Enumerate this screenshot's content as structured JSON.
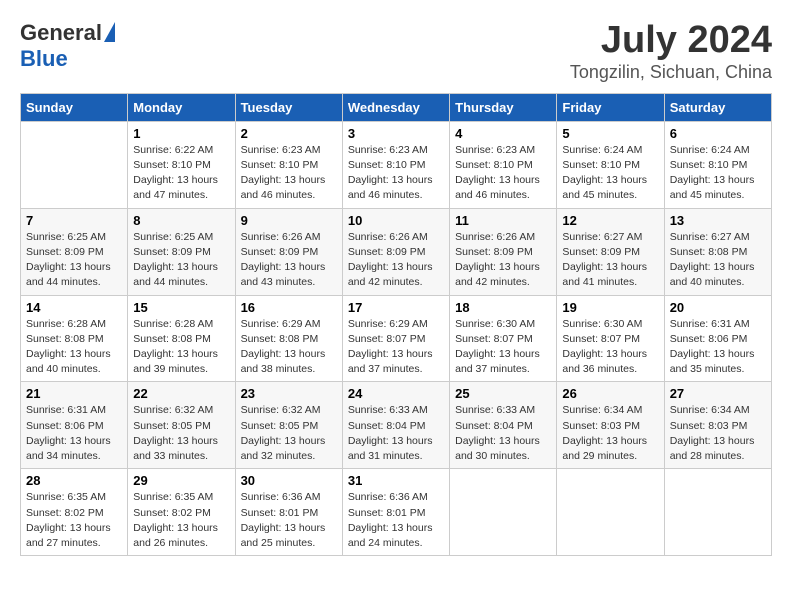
{
  "header": {
    "logo_general": "General",
    "logo_blue": "Blue",
    "month_year": "July 2024",
    "location": "Tongzilin, Sichuan, China"
  },
  "days_of_week": [
    "Sunday",
    "Monday",
    "Tuesday",
    "Wednesday",
    "Thursday",
    "Friday",
    "Saturday"
  ],
  "weeks": [
    [
      {
        "num": "",
        "detail": ""
      },
      {
        "num": "1",
        "detail": "Sunrise: 6:22 AM\nSunset: 8:10 PM\nDaylight: 13 hours\nand 47 minutes."
      },
      {
        "num": "2",
        "detail": "Sunrise: 6:23 AM\nSunset: 8:10 PM\nDaylight: 13 hours\nand 46 minutes."
      },
      {
        "num": "3",
        "detail": "Sunrise: 6:23 AM\nSunset: 8:10 PM\nDaylight: 13 hours\nand 46 minutes."
      },
      {
        "num": "4",
        "detail": "Sunrise: 6:23 AM\nSunset: 8:10 PM\nDaylight: 13 hours\nand 46 minutes."
      },
      {
        "num": "5",
        "detail": "Sunrise: 6:24 AM\nSunset: 8:10 PM\nDaylight: 13 hours\nand 45 minutes."
      },
      {
        "num": "6",
        "detail": "Sunrise: 6:24 AM\nSunset: 8:10 PM\nDaylight: 13 hours\nand 45 minutes."
      }
    ],
    [
      {
        "num": "7",
        "detail": "Sunrise: 6:25 AM\nSunset: 8:09 PM\nDaylight: 13 hours\nand 44 minutes."
      },
      {
        "num": "8",
        "detail": "Sunrise: 6:25 AM\nSunset: 8:09 PM\nDaylight: 13 hours\nand 44 minutes."
      },
      {
        "num": "9",
        "detail": "Sunrise: 6:26 AM\nSunset: 8:09 PM\nDaylight: 13 hours\nand 43 minutes."
      },
      {
        "num": "10",
        "detail": "Sunrise: 6:26 AM\nSunset: 8:09 PM\nDaylight: 13 hours\nand 42 minutes."
      },
      {
        "num": "11",
        "detail": "Sunrise: 6:26 AM\nSunset: 8:09 PM\nDaylight: 13 hours\nand 42 minutes."
      },
      {
        "num": "12",
        "detail": "Sunrise: 6:27 AM\nSunset: 8:09 PM\nDaylight: 13 hours\nand 41 minutes."
      },
      {
        "num": "13",
        "detail": "Sunrise: 6:27 AM\nSunset: 8:08 PM\nDaylight: 13 hours\nand 40 minutes."
      }
    ],
    [
      {
        "num": "14",
        "detail": "Sunrise: 6:28 AM\nSunset: 8:08 PM\nDaylight: 13 hours\nand 40 minutes."
      },
      {
        "num": "15",
        "detail": "Sunrise: 6:28 AM\nSunset: 8:08 PM\nDaylight: 13 hours\nand 39 minutes."
      },
      {
        "num": "16",
        "detail": "Sunrise: 6:29 AM\nSunset: 8:08 PM\nDaylight: 13 hours\nand 38 minutes."
      },
      {
        "num": "17",
        "detail": "Sunrise: 6:29 AM\nSunset: 8:07 PM\nDaylight: 13 hours\nand 37 minutes."
      },
      {
        "num": "18",
        "detail": "Sunrise: 6:30 AM\nSunset: 8:07 PM\nDaylight: 13 hours\nand 37 minutes."
      },
      {
        "num": "19",
        "detail": "Sunrise: 6:30 AM\nSunset: 8:07 PM\nDaylight: 13 hours\nand 36 minutes."
      },
      {
        "num": "20",
        "detail": "Sunrise: 6:31 AM\nSunset: 8:06 PM\nDaylight: 13 hours\nand 35 minutes."
      }
    ],
    [
      {
        "num": "21",
        "detail": "Sunrise: 6:31 AM\nSunset: 8:06 PM\nDaylight: 13 hours\nand 34 minutes."
      },
      {
        "num": "22",
        "detail": "Sunrise: 6:32 AM\nSunset: 8:05 PM\nDaylight: 13 hours\nand 33 minutes."
      },
      {
        "num": "23",
        "detail": "Sunrise: 6:32 AM\nSunset: 8:05 PM\nDaylight: 13 hours\nand 32 minutes."
      },
      {
        "num": "24",
        "detail": "Sunrise: 6:33 AM\nSunset: 8:04 PM\nDaylight: 13 hours\nand 31 minutes."
      },
      {
        "num": "25",
        "detail": "Sunrise: 6:33 AM\nSunset: 8:04 PM\nDaylight: 13 hours\nand 30 minutes."
      },
      {
        "num": "26",
        "detail": "Sunrise: 6:34 AM\nSunset: 8:03 PM\nDaylight: 13 hours\nand 29 minutes."
      },
      {
        "num": "27",
        "detail": "Sunrise: 6:34 AM\nSunset: 8:03 PM\nDaylight: 13 hours\nand 28 minutes."
      }
    ],
    [
      {
        "num": "28",
        "detail": "Sunrise: 6:35 AM\nSunset: 8:02 PM\nDaylight: 13 hours\nand 27 minutes."
      },
      {
        "num": "29",
        "detail": "Sunrise: 6:35 AM\nSunset: 8:02 PM\nDaylight: 13 hours\nand 26 minutes."
      },
      {
        "num": "30",
        "detail": "Sunrise: 6:36 AM\nSunset: 8:01 PM\nDaylight: 13 hours\nand 25 minutes."
      },
      {
        "num": "31",
        "detail": "Sunrise: 6:36 AM\nSunset: 8:01 PM\nDaylight: 13 hours\nand 24 minutes."
      },
      {
        "num": "",
        "detail": ""
      },
      {
        "num": "",
        "detail": ""
      },
      {
        "num": "",
        "detail": ""
      }
    ]
  ]
}
